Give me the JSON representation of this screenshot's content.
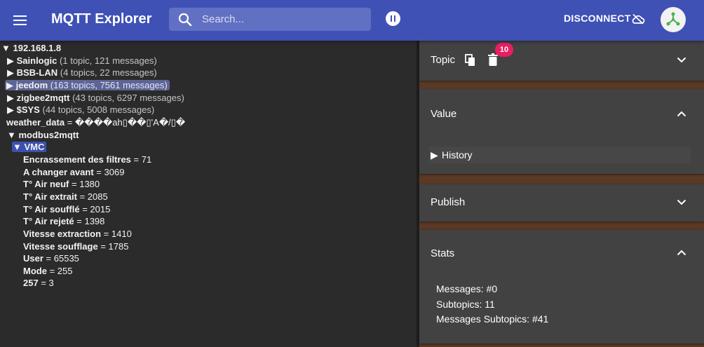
{
  "appbar": {
    "title": "MQTT Explorer",
    "search_placeholder": "Search...",
    "disconnect_label": "DISCONNECT",
    "icons": [
      "menu-icon",
      "search-icon",
      "pause-icon",
      "cloud-off-icon",
      "avatar-logo-icon"
    ],
    "bar_color": "#3f51b5"
  },
  "tree": {
    "root": "192.168.1.8",
    "nodes": [
      {
        "name": "Sainlogic",
        "meta": "(1 topic, 121 messages)"
      },
      {
        "name": "BSB-LAN",
        "meta": "(4 topics, 22 messages)"
      },
      {
        "name": "jeedom",
        "meta": "(163 topics, 7561 messages)"
      },
      {
        "name": "zigbee2mqtt",
        "meta": "(43 topics, 6297 messages)"
      },
      {
        "name": "$SYS",
        "meta": "(44 topics, 5008 messages)"
      }
    ],
    "weather": {
      "name": "weather_data",
      "value": "= ����ah▯��▯'A�/▯�"
    },
    "modbus": "modbus2mqtt",
    "vmc": "VMC",
    "vmc_items": [
      {
        "name": "Encrassement des filtres",
        "value": "= 71"
      },
      {
        "name": "A changer avant",
        "value": "= 3069"
      },
      {
        "name": "T° Air neuf",
        "value": "= 1380"
      },
      {
        "name": "T° Air extrait",
        "value": "= 2085"
      },
      {
        "name": "T° Air soufflé",
        "value": "= 2015"
      },
      {
        "name": "T° Air rejeté",
        "value": "= 1398"
      },
      {
        "name": "Vitesse extraction",
        "value": "= 1410"
      },
      {
        "name": "Vitesse soufflage",
        "value": "= 1785"
      },
      {
        "name": "User",
        "value": "= 65535"
      },
      {
        "name": "Mode",
        "value": "= 255"
      },
      {
        "name": "257",
        "value": "= 3"
      }
    ]
  },
  "sidebar": {
    "topic": {
      "title": "Topic",
      "badge": "10"
    },
    "value": {
      "title": "Value",
      "history": "History"
    },
    "publish": {
      "title": "Publish"
    },
    "stats": {
      "title": "Stats",
      "lines": [
        "Messages: #0",
        "Subtopics: 11",
        "Messages Subtopics: #41"
      ]
    }
  }
}
